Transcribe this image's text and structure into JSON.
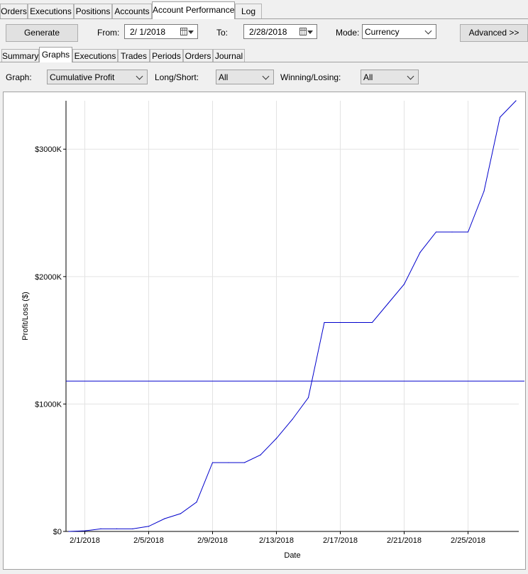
{
  "top_tabs": [
    {
      "label": "Orders",
      "active": false
    },
    {
      "label": "Executions",
      "active": false
    },
    {
      "label": "Positions",
      "active": false
    },
    {
      "label": "Accounts",
      "active": false
    },
    {
      "label": "Account Performance",
      "active": true
    },
    {
      "label": "Log",
      "active": false
    }
  ],
  "toolbar": {
    "generate_label": "Generate",
    "from_label": "From:",
    "from_value": "2/  1/2018",
    "to_label": "To:",
    "to_value": "2/28/2018",
    "mode_label": "Mode:",
    "mode_value": "Currency",
    "advanced_label": "Advanced >>"
  },
  "sub_tabs": [
    {
      "label": "Summary",
      "active": false
    },
    {
      "label": "Graphs",
      "active": true
    },
    {
      "label": "Executions",
      "active": false
    },
    {
      "label": "Trades",
      "active": false
    },
    {
      "label": "Periods",
      "active": false
    },
    {
      "label": "Orders",
      "active": false
    },
    {
      "label": "Journal",
      "active": false
    }
  ],
  "graph_options": {
    "graph_label": "Graph:",
    "graph_value": "Cumulative Profit",
    "long_short_label": "Long/Short:",
    "long_short_value": "All",
    "win_lose_label": "Winning/Losing:",
    "win_lose_value": "All"
  },
  "icons": {
    "calendar": "calendar-icon",
    "dropdown": "chevron-down-icon"
  },
  "chart_data": {
    "type": "line",
    "xlabel": "Date",
    "ylabel": "Profit/Loss ($)",
    "x_tick_labels": [
      "2/1/2018",
      "2/5/2018",
      "2/9/2018",
      "2/13/2018",
      "2/17/2018",
      "2/21/2018",
      "2/25/2018"
    ],
    "y_tick_labels": [
      "$0",
      "$1000K",
      "$2000K",
      "$3000K"
    ],
    "ylim": [
      0,
      3380
    ],
    "y_units": "thousands of dollars",
    "grid": true,
    "line_color": "#0000cc",
    "reference_line_value": 1180,
    "series": [
      {
        "x": [
          "2018-01-31",
          "2018-02-01",
          "2018-02-02",
          "2018-02-03",
          "2018-02-04",
          "2018-02-05",
          "2018-02-06",
          "2018-02-07",
          "2018-02-08",
          "2018-02-09",
          "2018-02-10",
          "2018-02-11",
          "2018-02-12",
          "2018-02-13",
          "2018-02-14",
          "2018-02-15",
          "2018-02-16",
          "2018-02-17",
          "2018-02-18",
          "2018-02-19",
          "2018-02-20",
          "2018-02-21",
          "2018-02-22",
          "2018-02-23",
          "2018-02-24",
          "2018-02-25",
          "2018-02-26",
          "2018-02-27",
          "2018-02-28"
        ],
        "values": [
          0,
          5,
          20,
          20,
          20,
          40,
          100,
          140,
          230,
          540,
          540,
          540,
          600,
          730,
          880,
          1050,
          1640,
          1640,
          1640,
          1640,
          1790,
          1940,
          2190,
          2350,
          2350,
          2350,
          2670,
          3250,
          3380
        ]
      }
    ]
  }
}
